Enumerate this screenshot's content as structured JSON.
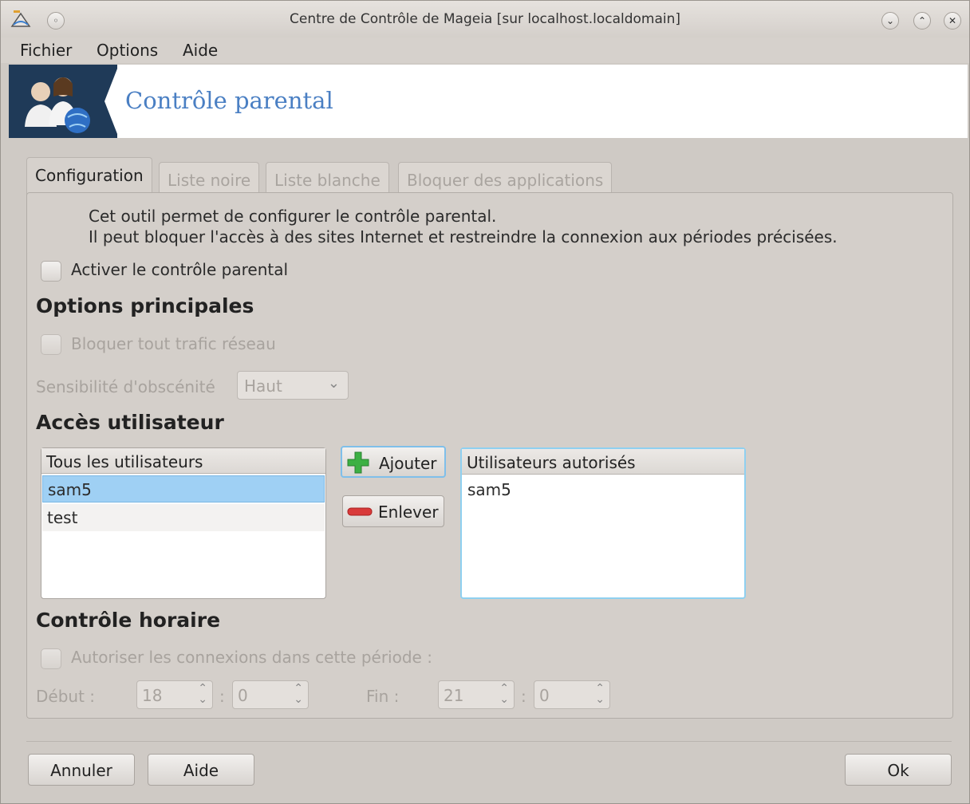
{
  "window": {
    "title": "Centre de Contrôle de Mageia  [sur localhost.localdomain]"
  },
  "menu": {
    "items": [
      "Fichier",
      "Options",
      "Aide"
    ]
  },
  "banner": {
    "title": "Contrôle parental"
  },
  "tabs": [
    "Configuration",
    "Liste noire",
    "Liste blanche",
    "Bloquer des applications"
  ],
  "config": {
    "description_line1": "Cet outil permet de configurer le contrôle parental.",
    "description_line2": "Il peut bloquer l'accès à des sites Internet et restreindre la connexion aux périodes précisées.",
    "enable_label": "Activer le contrôle parental",
    "main_options_heading": "Options principales",
    "block_traffic_label": "Bloquer tout trafic réseau",
    "obscenity_label": "Sensibilité d'obscénité",
    "obscenity_value": "Haut",
    "user_access_heading": "Accès utilisateur",
    "all_users_header": "Tous les utilisateurs",
    "all_users": [
      "sam5",
      "test"
    ],
    "add_button": "Ajouter",
    "remove_button": "Enlever",
    "allowed_users_header": "Utilisateurs autorisés",
    "allowed_users": [
      "sam5"
    ],
    "time_control_heading": "Contrôle horaire",
    "allow_period_label": "Autoriser les connexions dans cette période :",
    "start_label": "Début :",
    "start_hour": "18",
    "start_minute": "0",
    "end_label": "Fin :",
    "end_hour": "21",
    "end_minute": "0",
    "time_separator": ":"
  },
  "footer": {
    "cancel": "Annuler",
    "help": "Aide",
    "ok": "Ok"
  },
  "colors": {
    "accent": "#4a7fc3",
    "selection": "#9fd0f4",
    "add_icon": "#3cb043",
    "remove_icon": "#d93a3a"
  }
}
